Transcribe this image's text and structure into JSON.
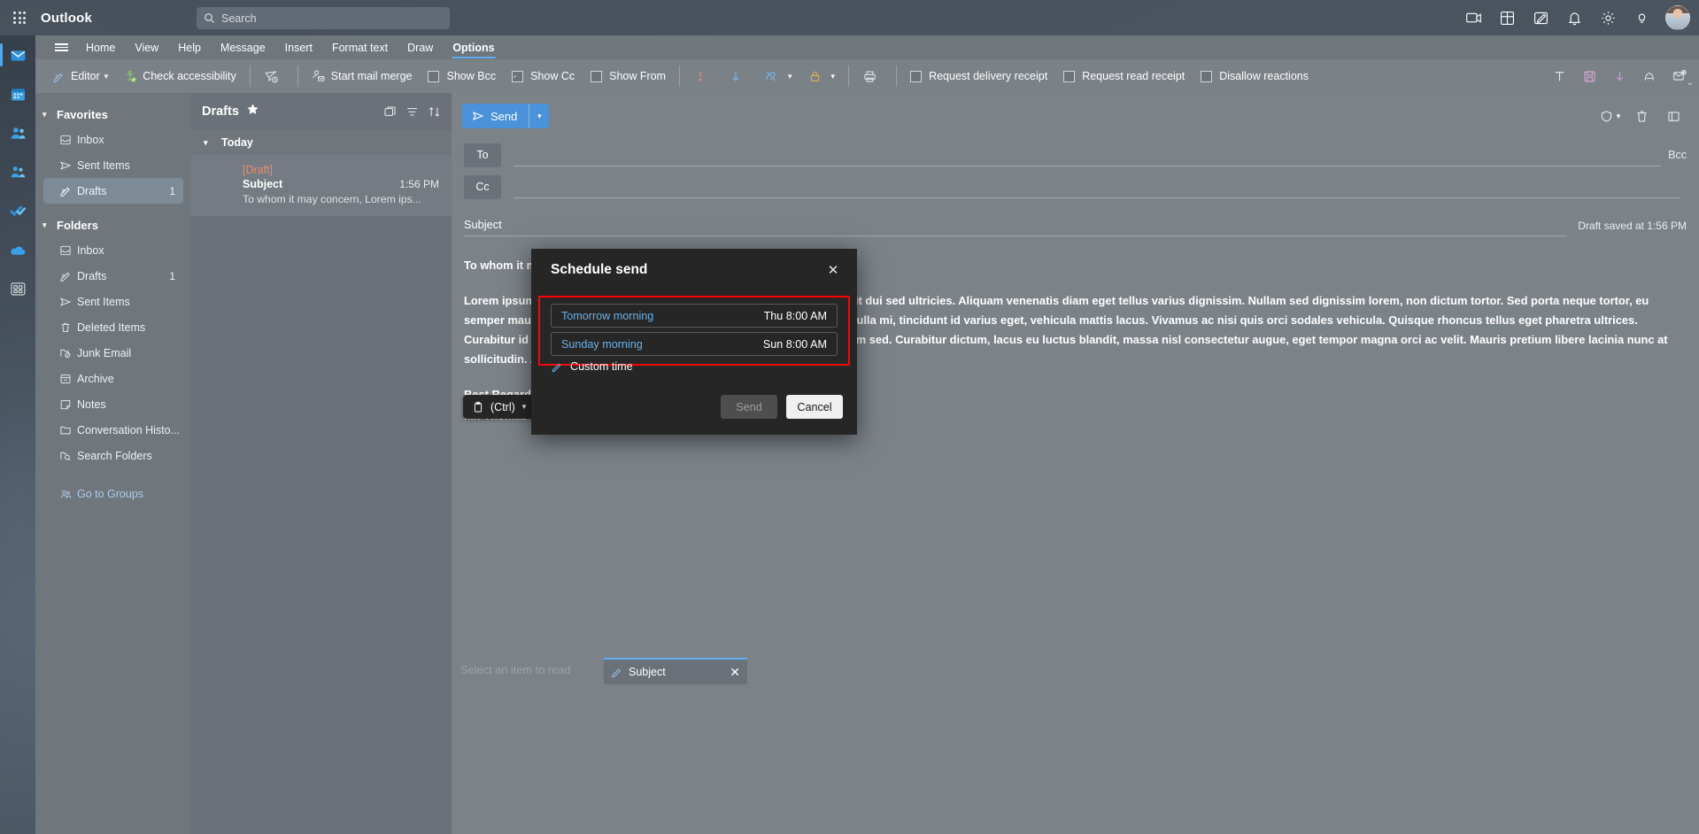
{
  "appbar": {
    "waffle_label": "App launcher",
    "brand": "Outlook",
    "search_placeholder": "Search",
    "icons": [
      "meeting-icon",
      "apps-icon",
      "note-icon",
      "bell-icon",
      "gear-icon",
      "lightbulb-icon"
    ]
  },
  "ribbon": {
    "tabs": [
      {
        "label": "Home",
        "active": false
      },
      {
        "label": "View",
        "active": false
      },
      {
        "label": "Help",
        "active": false
      },
      {
        "label": "Message",
        "active": false
      },
      {
        "label": "Insert",
        "active": false
      },
      {
        "label": "Format text",
        "active": false
      },
      {
        "label": "Draw",
        "active": false
      },
      {
        "label": "Options",
        "active": true
      }
    ],
    "editor_label": "Editor",
    "check_accessibility_label": "Check accessibility",
    "start_mail_merge_label": "Start mail merge",
    "show_bcc_label": "Show Bcc",
    "show_bcc_checked": false,
    "show_cc_label": "Show Cc",
    "show_cc_checked": true,
    "show_from_label": "Show From",
    "show_from_checked": false,
    "request_delivery_receipt_label": "Request delivery receipt",
    "request_delivery_receipt_checked": false,
    "request_read_receipt_label": "Request read receipt",
    "request_read_receipt_checked": false,
    "disallow_reactions_label": "Disallow reactions",
    "disallow_reactions_checked": false,
    "collapse_label": "⌄"
  },
  "rail": {
    "items": [
      "mail-icon",
      "calendar-icon",
      "people-icon",
      "groups-icon",
      "todo-icon",
      "onedrive-icon",
      "apps-icon"
    ]
  },
  "folders": {
    "favorites_label": "Favorites",
    "favorites": [
      {
        "label": "Inbox",
        "icon": "inbox-icon",
        "count": "",
        "selected": false
      },
      {
        "label": "Sent Items",
        "icon": "send-icon",
        "count": "",
        "selected": false
      },
      {
        "label": "Drafts",
        "icon": "draft-icon",
        "count": "1",
        "selected": true
      }
    ],
    "folders_label": "Folders",
    "folders": [
      {
        "label": "Inbox",
        "icon": "inbox-icon",
        "count": ""
      },
      {
        "label": "Drafts",
        "icon": "draft-icon",
        "count": "1"
      },
      {
        "label": "Sent Items",
        "icon": "send-icon",
        "count": ""
      },
      {
        "label": "Deleted Items",
        "icon": "trash-icon",
        "count": ""
      },
      {
        "label": "Junk Email",
        "icon": "junk-icon",
        "count": ""
      },
      {
        "label": "Archive",
        "icon": "archive-icon",
        "count": ""
      },
      {
        "label": "Notes",
        "icon": "notes-icon",
        "count": ""
      },
      {
        "label": "Conversation Histo...",
        "icon": "folder-icon",
        "count": ""
      },
      {
        "label": "Search Folders",
        "icon": "search-folder-icon",
        "count": ""
      }
    ],
    "go_to_groups_label": "Go to Groups"
  },
  "list": {
    "title": "Drafts",
    "today_label": "Today",
    "item": {
      "draft_tag": "[Draft]",
      "subject": "Subject",
      "time": "1:56 PM",
      "preview": "To whom it may concern, Lorem ips..."
    }
  },
  "compose": {
    "send_label": "Send",
    "to_label": "To",
    "cc_label": "Cc",
    "bcc_label": "Bcc",
    "subject_label": "Subject",
    "draft_saved": "Draft saved at 1:56 PM",
    "body_greeting": "To whom it may concern,",
    "body_paragraph": "Lorem ipsum dolor sit amet, consectetur adipiscing elit. Quisque suscipit dui sed ultricies. Aliquam venenatis diam eget tellus varius dignissim. Nullam sed dignissim lorem, non dictum tortor. Sed porta neque tortor, eu semper mauris luctus vitae. Integer egestas iaculis malesuada. Integer nulla mi, tincidunt id varius eget, vehicula mattis lacus. Vivamus ac nisi quis orci sodales vehicula. Quisque rhoncus tellus eget pharetra ultrices. Curabitur id odio. Praesent sodales tellus neque, vitae rhoncus est rutrum sed. Curabitur dictum, lacus eu luctus blandit, massa nisl consectetur augue, eget tempor magna orci ac velit. Mauris pretium libere lacinia nunc at sollicitudin. Aenean ornare nibh nec nulla ultricies condimentum.",
    "body_signoff": "Best Regards,",
    "body_signature": "Mr. Thomas W",
    "clipboard_pill_label": "(Ctrl)"
  },
  "bottom": {
    "select_item_label": "Select an item to read",
    "task_tab_label": "Subject"
  },
  "modal": {
    "title": "Schedule send",
    "close_label": "✕",
    "options": [
      {
        "label": "Tomorrow morning",
        "time": "Thu 8:00 AM"
      },
      {
        "label": "Sunday morning",
        "time": "Sun 8:00 AM"
      }
    ],
    "custom_time_label": "Custom time",
    "send_label": "Send",
    "cancel_label": "Cancel",
    "highlight_color": "#ff0008"
  }
}
